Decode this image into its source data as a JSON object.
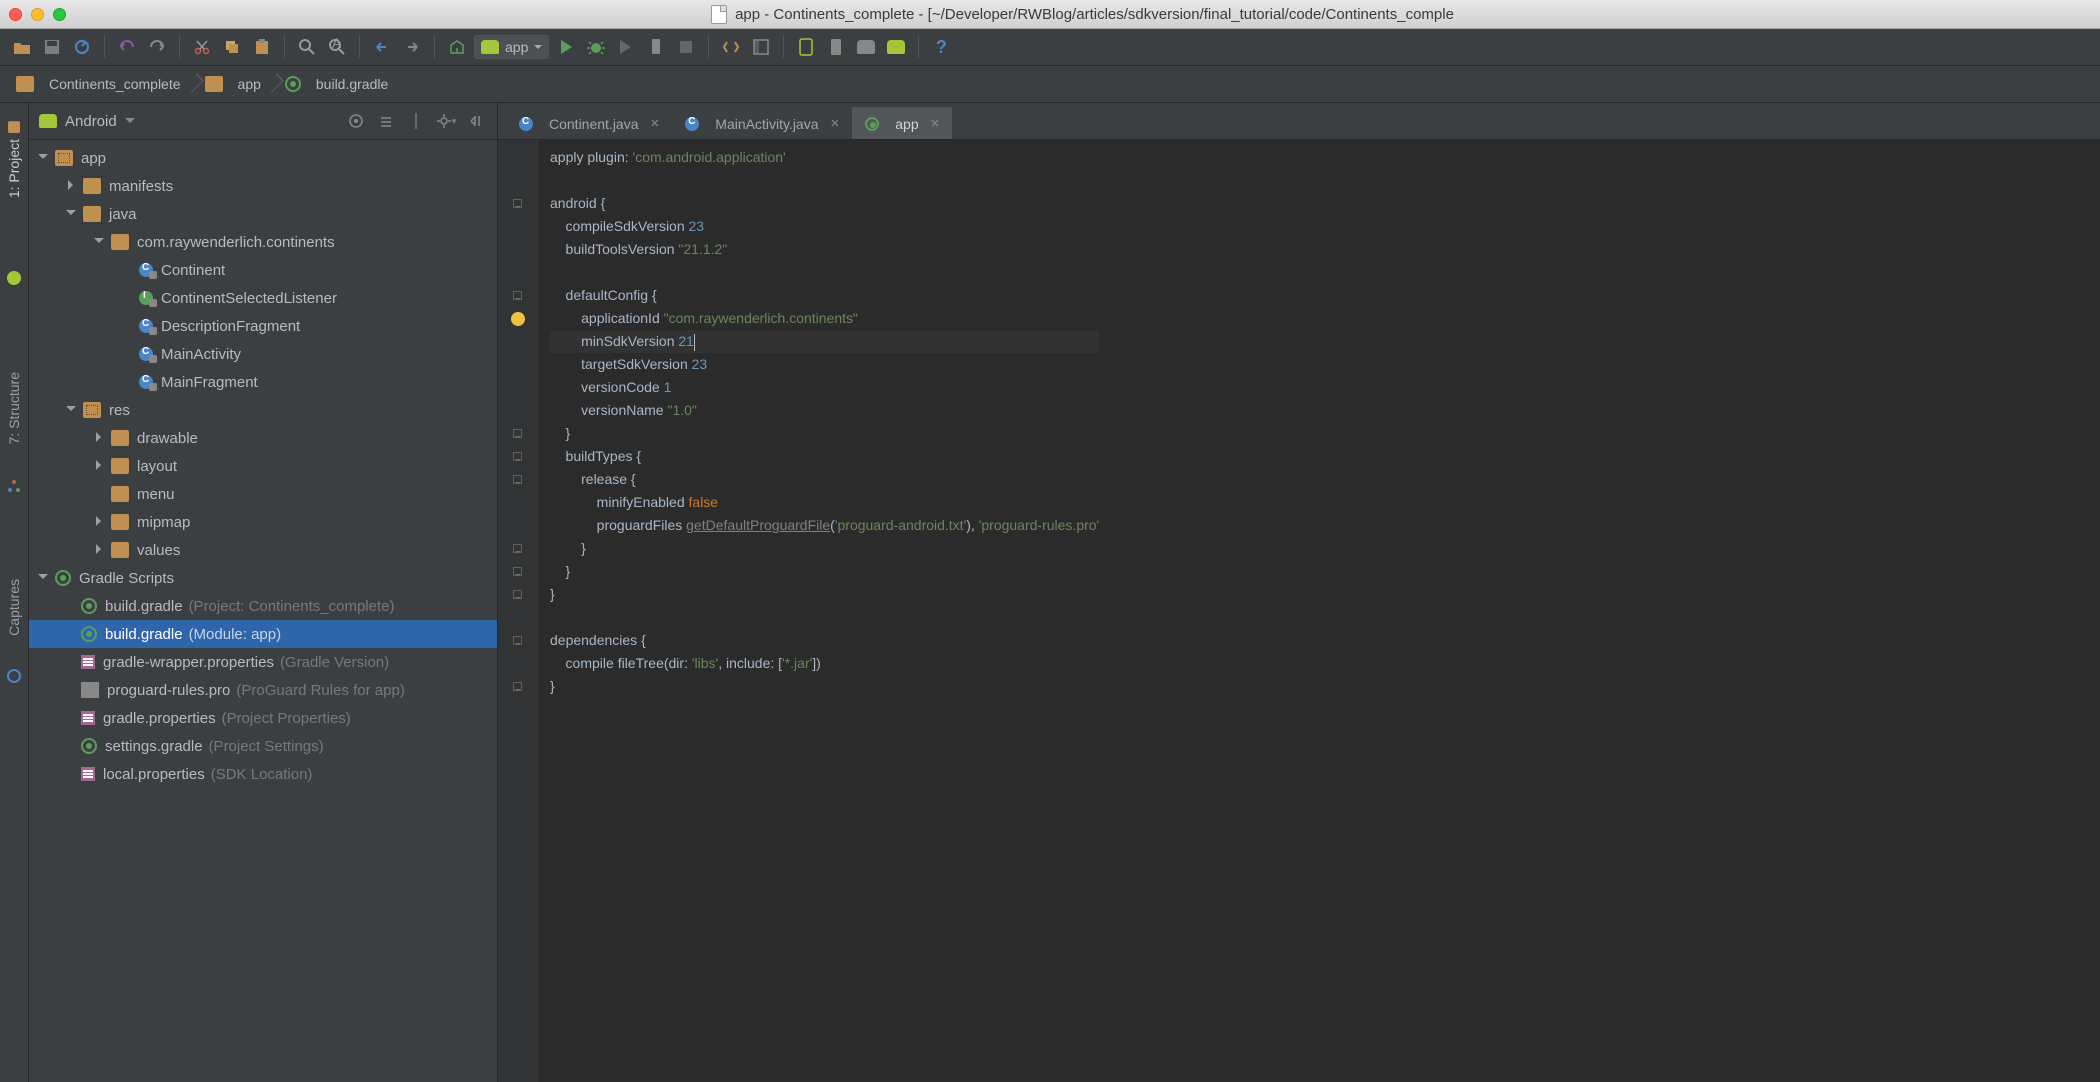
{
  "window_title": "app - Continents_complete - [~/Developer/RWBlog/articles/sdkversion/final_tutorial/code/Continents_comple",
  "run_config": "app",
  "breadcrumbs": [
    {
      "label": "Continents_complete",
      "icon": "folder"
    },
    {
      "label": "app",
      "icon": "folder"
    },
    {
      "label": "build.gradle",
      "icon": "gradle"
    }
  ],
  "project_view_label": "Android",
  "side_tabs": [
    "1: Project",
    "7: Structure",
    "Captures"
  ],
  "tree": {
    "app": "app",
    "manifests": "manifests",
    "java": "java",
    "pkg": "com.raywenderlich.continents",
    "classes": [
      "Continent",
      "ContinentSelectedListener",
      "DescriptionFragment",
      "MainActivity",
      "MainFragment"
    ],
    "res": "res",
    "res_children": [
      "drawable",
      "layout",
      "menu",
      "mipmap",
      "values"
    ],
    "gradle_scripts": "Gradle Scripts",
    "gs": [
      {
        "name": "build.gradle",
        "hint": "(Project: Continents_complete)"
      },
      {
        "name": "build.gradle",
        "hint": "(Module: app)"
      },
      {
        "name": "gradle-wrapper.properties",
        "hint": "(Gradle Version)"
      },
      {
        "name": "proguard-rules.pro",
        "hint": "(ProGuard Rules for app)"
      },
      {
        "name": "gradle.properties",
        "hint": "(Project Properties)"
      },
      {
        "name": "settings.gradle",
        "hint": "(Project Settings)"
      },
      {
        "name": "local.properties",
        "hint": "(SDK Location)"
      }
    ]
  },
  "editor_tabs": [
    {
      "label": "Continent.java",
      "icon": "class"
    },
    {
      "label": "MainActivity.java",
      "icon": "class"
    },
    {
      "label": "app",
      "icon": "gradle",
      "active": true
    }
  ],
  "code": {
    "l1_a": "apply plugin: ",
    "l1_b": "'com.android.application'",
    "l3": "android {",
    "l4_a": "    compileSdkVersion ",
    "l4_b": "23",
    "l5_a": "    buildToolsVersion ",
    "l5_b": "\"21.1.2\"",
    "l7": "    defaultConfig {",
    "l8_a": "        applicationId ",
    "l8_b": "\"com.raywenderlich.continents\"",
    "l9_a": "        minSdkVersion ",
    "l9_b": "21",
    "l10_a": "        targetSdkVersion ",
    "l10_b": "23",
    "l11_a": "        versionCode ",
    "l11_b": "1",
    "l12_a": "        versionName ",
    "l12_b": "\"1.0\"",
    "l13": "    }",
    "l14": "    buildTypes {",
    "l15": "        release {",
    "l16_a": "            minifyEnabled ",
    "l16_b": "false",
    "l17_a": "            proguardFiles ",
    "l17_b": "getDefaultProguardFile",
    "l17_c": "(",
    "l17_d": "'proguard-android.txt'",
    "l17_e": "), ",
    "l17_f": "'proguard-rules.pro'",
    "l18": "        }",
    "l19": "    }",
    "l20": "}",
    "l22": "dependencies {",
    "l23_a": "    compile fileTree(dir: ",
    "l23_b": "'libs'",
    "l23_c": ", include: [",
    "l23_d": "'*.jar'",
    "l23_e": "])",
    "l24": "}"
  }
}
